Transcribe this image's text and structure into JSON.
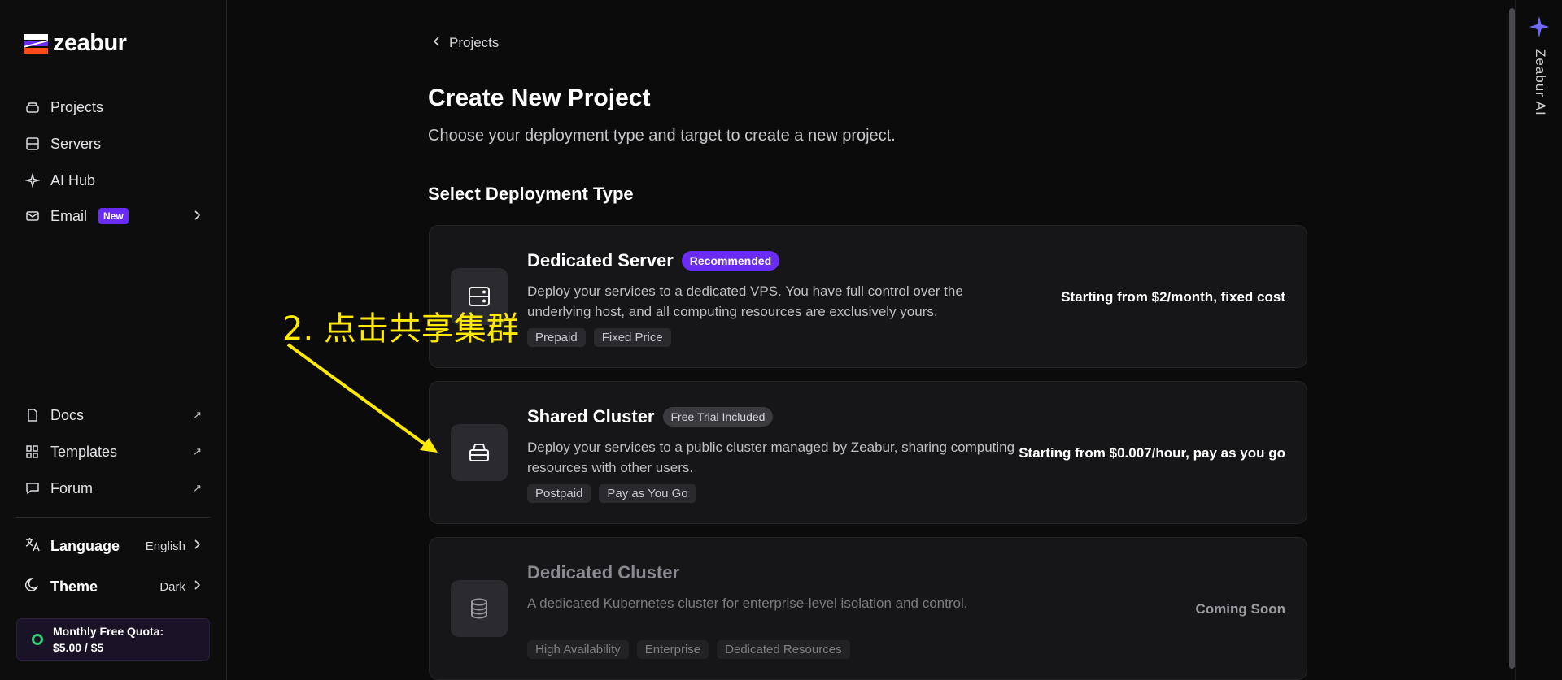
{
  "brand": {
    "name": "zeabur"
  },
  "sidebar": {
    "nav": [
      {
        "label": "Projects",
        "icon": "stack-icon"
      },
      {
        "label": "Servers",
        "icon": "server-icon"
      },
      {
        "label": "AI Hub",
        "icon": "sparkle-icon"
      },
      {
        "label": "Email",
        "icon": "mail-icon",
        "badge": "New"
      }
    ],
    "links": [
      {
        "label": "Docs",
        "icon": "doc-icon"
      },
      {
        "label": "Templates",
        "icon": "grid-icon"
      },
      {
        "label": "Forum",
        "icon": "chat-icon"
      }
    ],
    "language": {
      "label": "Language",
      "value": "English"
    },
    "theme": {
      "label": "Theme",
      "value": "Dark"
    },
    "quota": {
      "line1": "Monthly Free Quota:",
      "line2": "$5.00 / $5"
    }
  },
  "main": {
    "back_label": "Projects",
    "title": "Create New Project",
    "subtitle": "Choose your deployment type and target to create a new project.",
    "section_title": "Select Deployment Type",
    "cards": [
      {
        "title": "Dedicated Server",
        "pill": "Recommended",
        "desc": "Deploy your services to a dedicated VPS. You have full control over the underlying host, and all computing resources are exclusively yours.",
        "tags": [
          "Prepaid",
          "Fixed Price"
        ],
        "price": "Starting from $2/month, fixed cost"
      },
      {
        "title": "Shared Cluster",
        "pill": "Free Trial Included",
        "desc": "Deploy your services to a public cluster managed by Zeabur, sharing computing resources with other users.",
        "tags": [
          "Postpaid",
          "Pay as You Go"
        ],
        "price": "Starting from $0.007/hour, pay as you go"
      },
      {
        "title": "Dedicated Cluster",
        "desc": "A dedicated Kubernetes cluster for enterprise-level isolation and control.",
        "tags": [
          "High Availability",
          "Enterprise",
          "Dedicated Resources"
        ],
        "price": "Coming Soon"
      }
    ]
  },
  "annotation": {
    "text": "2.  点击共享集群",
    "color": "#ffea00"
  },
  "ai_panel": {
    "label": "Zeabur AI"
  },
  "colors": {
    "accent": "#6a2cf5",
    "quota_ring": "#2ecc71"
  }
}
